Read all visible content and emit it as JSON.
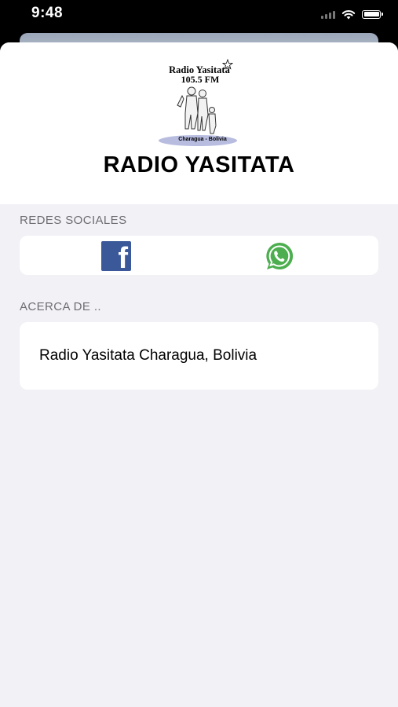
{
  "status_bar": {
    "time": "9:48"
  },
  "header": {
    "logo": {
      "name_line": "Radio Yasitata",
      "freq_line": "105.5 FM",
      "place_line": "Charagua - Bolivia"
    },
    "title": "RADIO YASITATA"
  },
  "social": {
    "section_label": "REDES SOCIALES",
    "buttons": [
      {
        "icon": "facebook-icon",
        "color": "#3b5998"
      },
      {
        "icon": "whatsapp-icon",
        "color": "#4cae4f"
      }
    ]
  },
  "about": {
    "section_label": "ACERCA DE ..",
    "text": "Radio Yasitata Charagua, Bolivia"
  },
  "colors": {
    "background": "#f1f1f6",
    "card": "#ffffff",
    "label": "#6d6d72"
  }
}
